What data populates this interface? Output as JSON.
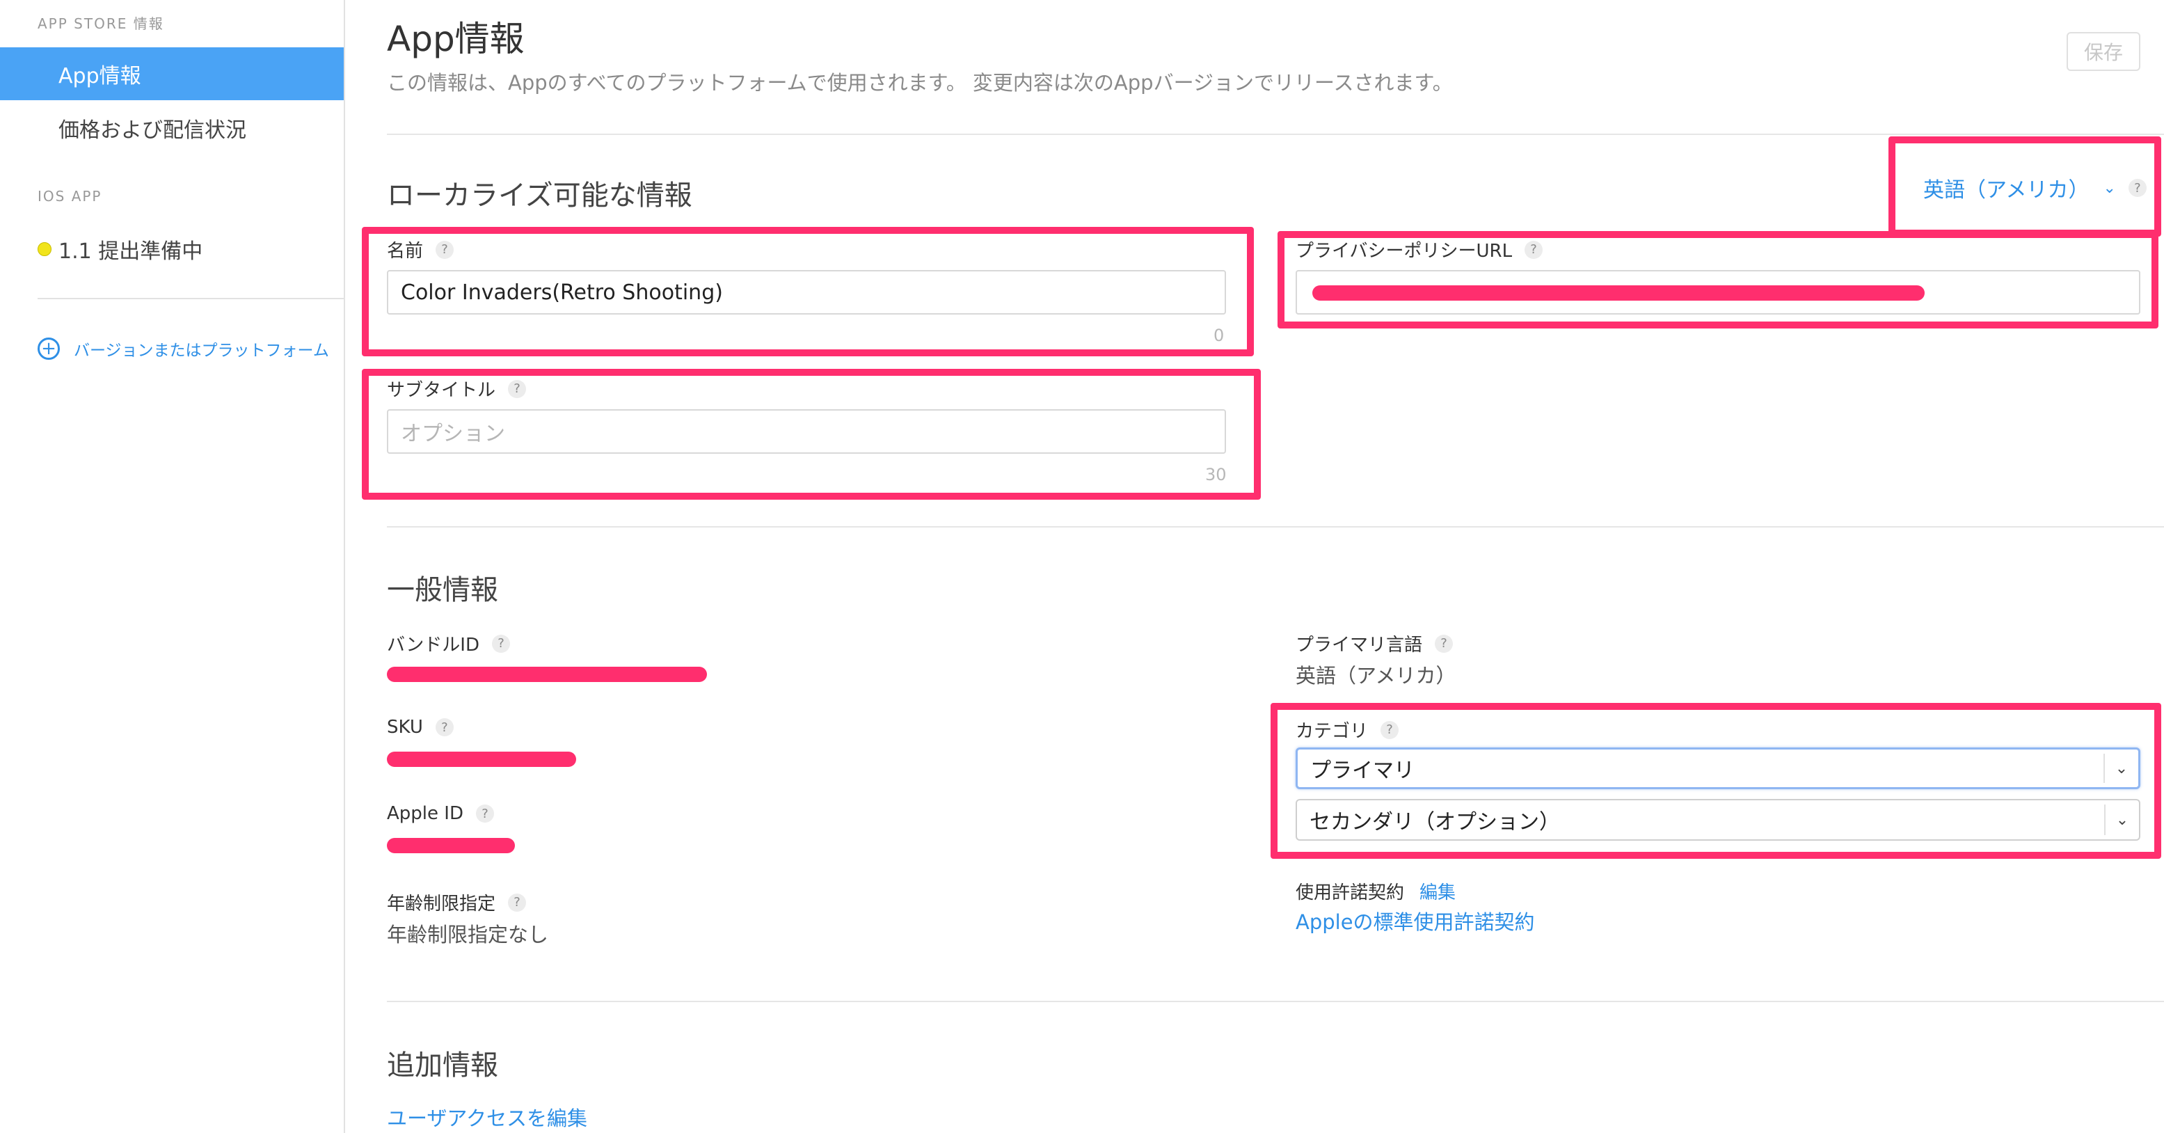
{
  "sidebar": {
    "app_store_heading": "APP STORE 情報",
    "items": [
      {
        "label": "App情報"
      },
      {
        "label": "価格および配信状況"
      }
    ],
    "ios_heading": "IOS APP",
    "version_item": {
      "label": "1.1 提出準備中",
      "status_color": "#f1e41c"
    },
    "add_version": "バージョンまたはプラットフォーム"
  },
  "header": {
    "title": "App情報",
    "description": "この情報は、Appのすべてのプラットフォームで使用されます。 変更内容は次のAppバージョンでリリースされます。",
    "save_label": "保存"
  },
  "localizable": {
    "section_title": "ローカライズ可能な情報",
    "language": "英語（アメリカ）",
    "name_label": "名前",
    "name_value": "Color Invaders(Retro Shooting)",
    "name_counter": "0",
    "subtitle_label": "サブタイトル",
    "subtitle_placeholder": "オプション",
    "subtitle_counter": "30",
    "privacy_label": "プライバシーポリシーURL",
    "help": "?"
  },
  "general": {
    "section_title": "一般情報",
    "bundle_id_label": "バンドルID",
    "sku_label": "SKU",
    "apple_id_label": "Apple ID",
    "age_rating_label": "年齢制限指定",
    "age_rating_value": "年齢制限指定なし",
    "primary_language_label": "プライマリ言語",
    "primary_language_value": "英語（アメリカ）",
    "category_label": "カテゴリ",
    "category_primary": "プライマリ",
    "category_secondary": "セカンダリ（オプション）",
    "license_label": "使用許諾契約",
    "license_edit": "編集",
    "license_link": "Appleの標準使用許諾契約"
  },
  "additional": {
    "section_title": "追加情報",
    "user_access_link": "ユーザアクセスを編集"
  },
  "colors": {
    "accent": "#2e8fe6",
    "sidebar_active": "#4aa3f5",
    "highlight": "#ff2e6e"
  }
}
